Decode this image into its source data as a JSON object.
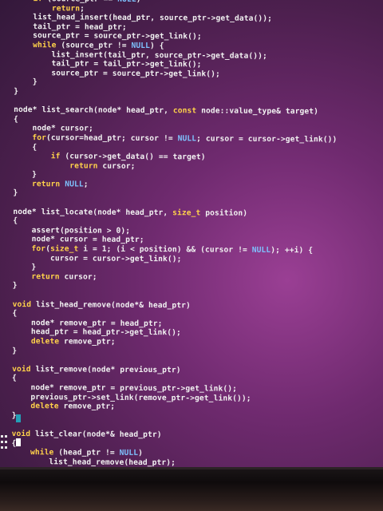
{
  "editor": {
    "lines": [
      "    if (source_ptr == NULL)",
      "        return;",
      "    list_head_insert(head_ptr, source_ptr->get_data());",
      "    tail_ptr = head_ptr;",
      "    source_ptr = source_ptr->get_link();",
      "    while (source_ptr != NULL) {",
      "        list_insert(tail_ptr, source_ptr->get_data());",
      "        tail_ptr = tail_ptr->get_link();",
      "        source_ptr = source_ptr->get_link();",
      "    }",
      "}",
      "",
      "node* list_search(node* head_ptr, const node::value_type& target)",
      "{",
      "    node* cursor;",
      "    for(cursor=head_ptr; cursor != NULL; cursor = cursor->get_link())",
      "    {",
      "        if (cursor->get_data() == target)",
      "            return cursor;",
      "    }",
      "    return NULL;",
      "}",
      "",
      "node* list_locate(node* head_ptr, size_t position)",
      "{",
      "    assert(position > 0);",
      "    node* cursor = head_ptr;",
      "    for(size_t i = 1; (i < position) && (cursor != NULL); ++i) {",
      "        cursor = cursor->get_link();",
      "    }",
      "    return cursor;",
      "}",
      "",
      "void list_head_remove(node*& head_ptr)",
      "{",
      "    node* remove_ptr = head_ptr;",
      "    head_ptr = head_ptr->get_link();",
      "    delete remove_ptr;",
      "}",
      "",
      "void list_remove(node* previous_ptr)",
      "{",
      "    node* remove_ptr = previous_ptr->get_link();",
      "    previous_ptr->set_link(remove_ptr->get_link());",
      "    delete remove_ptr;",
      "}",
      "",
      "void list_clear(node*& head_ptr)",
      "{",
      "    while (head_ptr != NULL)",
      "        list_head_remove(head_ptr);"
    ]
  },
  "colors": {
    "screen_background": "#6f2a6f",
    "code_text": "#f2f2f2",
    "keyword": "#ffd24a",
    "null_literal": "#7ec3ff",
    "matched_brace_highlight": "#1fb6c9",
    "cursor": "#ffffff"
  }
}
